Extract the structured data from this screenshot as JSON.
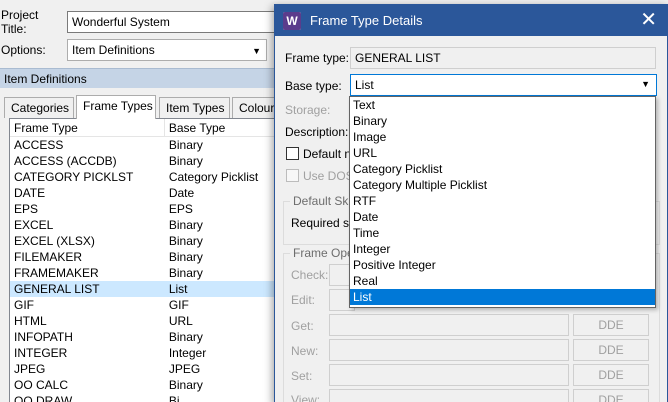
{
  "main": {
    "project_title_label": "Project Title:",
    "project_title_value": "Wonderful System",
    "options_label": "Options:",
    "options_value": "Item Definitions",
    "section_title": "Item Definitions",
    "tabs": [
      "Categories",
      "Frame Types",
      "Item Types",
      "Colour"
    ],
    "active_tab": "Frame Types",
    "columns": [
      "Frame Type",
      "Base Type"
    ],
    "rows": [
      {
        "frame": "ACCESS",
        "base": "Binary"
      },
      {
        "frame": "ACCESS (ACCDB)",
        "base": "Binary"
      },
      {
        "frame": "CATEGORY PICKLST",
        "base": "Category Picklist"
      },
      {
        "frame": "DATE",
        "base": "Date"
      },
      {
        "frame": "EPS",
        "base": "EPS"
      },
      {
        "frame": "EXCEL",
        "base": "Binary"
      },
      {
        "frame": "EXCEL (XLSX)",
        "base": "Binary"
      },
      {
        "frame": "FILEMAKER",
        "base": "Binary"
      },
      {
        "frame": "FRAMEMAKER",
        "base": "Binary"
      },
      {
        "frame": "GENERAL LIST",
        "base": "List"
      },
      {
        "frame": "GIF",
        "base": "GIF"
      },
      {
        "frame": "HTML",
        "base": "URL"
      },
      {
        "frame": "INFOPATH",
        "base": "Binary"
      },
      {
        "frame": "INTEGER",
        "base": "Integer"
      },
      {
        "frame": "JPEG",
        "base": "JPEG"
      },
      {
        "frame": "OO CALC",
        "base": "Binary"
      },
      {
        "frame": "OO DRAW",
        "base": "Bi"
      }
    ],
    "selected_row": 9
  },
  "dialog": {
    "icon_letter": "W",
    "title": "Frame Type Details",
    "close_glyph": "✕",
    "frame_type_label": "Frame type:",
    "frame_type_value": "GENERAL LIST",
    "base_type_label": "Base type:",
    "base_type_value": "List",
    "storage_label": "Storage:",
    "description_label": "Description:",
    "default_checkbox_label": "Default n",
    "dos_checkbox_label": "Use DOS-",
    "default_skill_group": "Default Skil",
    "required_label": "Required sk",
    "frame_ops_group": "Frame Ope",
    "ops": [
      "Check:",
      "Edit:",
      "Get:",
      "New:",
      "Set:",
      "View:"
    ],
    "dde_label": "DDE"
  },
  "dropdown": {
    "options": [
      "Text",
      "Binary",
      "Image",
      "URL",
      "Category Picklist",
      "Category Multiple Picklist",
      "RTF",
      "Date",
      "Time",
      "Integer",
      "Positive Integer",
      "Real",
      "List"
    ],
    "selected_index": 12
  },
  "colors": {
    "titlebar": "#2b579a",
    "selection": "#0078d7",
    "row_selection": "#cce8ff",
    "section_band": "#c5d4e6"
  }
}
